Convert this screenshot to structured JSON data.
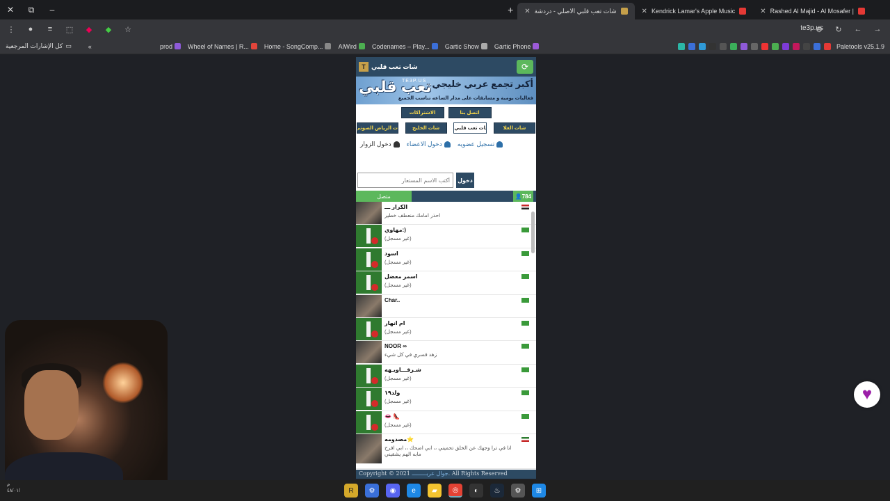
{
  "browser": {
    "tabs": [
      {
        "label": "شات تعب قلبي الاصلي - دردشة",
        "active": true,
        "favicon_color": "#c6a04a"
      },
      {
        "label": "Kendrick Lamar's Apple Music",
        "active": false,
        "favicon_color": "#e53935"
      },
      {
        "label": "Rashed Al Majid - Al Mosafer |",
        "active": false,
        "favicon_color": "#e53935"
      }
    ],
    "url": "te3p.us",
    "bookmarks_left": "كل الإشارات المرجعية",
    "bookmarks": [
      "prod",
      "Wheel of Names | R...",
      "Home - SongComp...",
      "AlWird",
      "Codenames – Play...",
      "Gartic Show",
      "Gartic Phone"
    ],
    "bookmarks_right": "Paletools v25.1.9"
  },
  "chat": {
    "header_title": "شات تعب قلبي",
    "logo_letter": "T",
    "banner": {
      "headline": "أكبر تجمع عربي خليجي",
      "subline": "فعاليات يومية و مسابقات على مدار الساعه تناسب الجميع",
      "logo_text": "تعب قلبي",
      "site": "TE3P.US"
    },
    "top_buttons": [
      "الاشتراكات",
      "اتصل بنا"
    ],
    "rooms": [
      "ت الرياض الصوتي",
      "شات الخليج",
      "شات تعب قلبي",
      "شات الغلا"
    ],
    "links": {
      "register": "تسجيل عضويه",
      "members_login": "دخول الاعضاء",
      "guest_login": "دخول الزوار"
    },
    "login": {
      "placeholder": "أكتب الاسم المستعار",
      "button": "دخول"
    },
    "online_label": "متصل",
    "online_count": "784",
    "users": [
      {
        "name": "الكرار ـــ",
        "status": "احذر امامك منعطف خطير",
        "avatar": "photo",
        "flag": "eg"
      },
      {
        "name": "مهاوي:)",
        "status": "(غير مسجل)",
        "avatar": "green",
        "flag": "sa"
      },
      {
        "name": "اسود",
        "status": "(غير مسجل)",
        "avatar": "green",
        "flag": "sa"
      },
      {
        "name": "اسمر معضل",
        "status": "(غير مسجل)",
        "avatar": "green",
        "flag": "sa"
      },
      {
        "name": "Char..",
        "status": "",
        "avatar": "photo",
        "flag": "sa"
      },
      {
        "name": "ام انهار",
        "status": "(غير مسجل)",
        "avatar": "green",
        "flag": "sa"
      },
      {
        "name": "NOOR ∞",
        "status": "زهد قسري في كل شيء",
        "avatar": "photo",
        "flag": "sa"
      },
      {
        "name": "شـرقـــاويـهه",
        "status": "(غير مسجل)",
        "avatar": "green",
        "flag": "sa"
      },
      {
        "name": "ولد١٩",
        "status": "(غير مسجل)",
        "avatar": "green",
        "flag": "sa"
      },
      {
        "name": "👄 👠",
        "status": "(غير مسجل)",
        "avatar": "green",
        "flag": "sa"
      },
      {
        "name": "مصدومه⭐",
        "status": "انا في ترا وجهك عن الخلق تحميني ،، ابي اضحك ،، ابي افرح مابه الهم يشقيني",
        "avatar": "photo",
        "flag": "kw"
      }
    ],
    "footer_prefix": "Copyright © 2021",
    "footer_link": "جوال عربـــــــــ",
    "footer_suffix": ". All Rights Reserved"
  },
  "taskbar": {
    "clock_time": "م",
    "clock_date": "٤٨/٠١/"
  },
  "colors": {
    "brand": "#2d4a63",
    "online": "#5cb85c",
    "accent_text": "#f5d64a"
  }
}
